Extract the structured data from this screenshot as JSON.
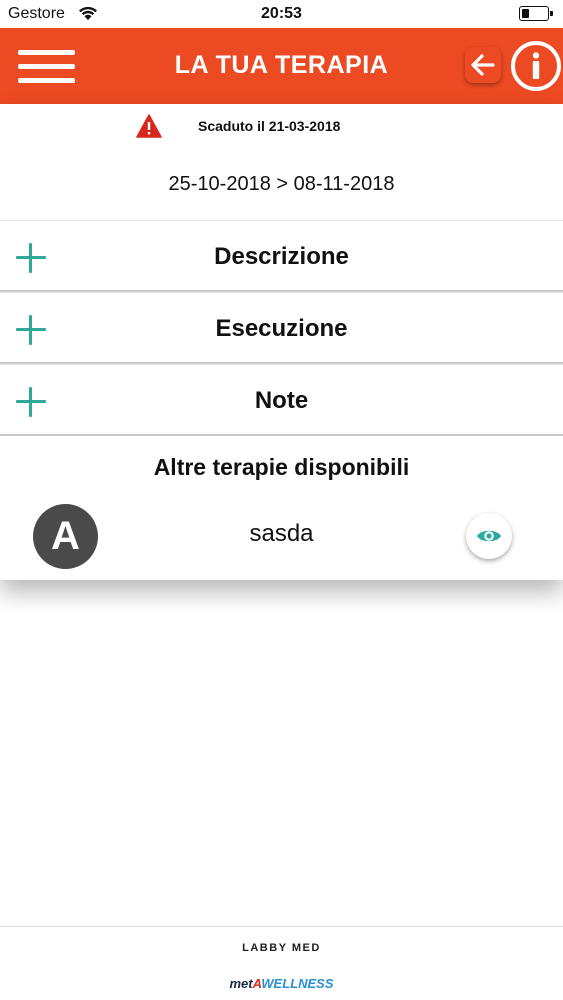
{
  "status_bar": {
    "carrier": "Gestore",
    "time": "20:53",
    "battery_level": 0.3
  },
  "header": {
    "title": "LA TUA TERAPIA",
    "menu_icon": "hamburger-icon",
    "back_icon": "arrow-left-icon",
    "info_icon": "info-icon"
  },
  "therapy": {
    "expired_text": "Scaduto il 21-03-2018",
    "date_range": "25-10-2018 > 08-11-2018"
  },
  "sections": [
    {
      "label": "Descrizione"
    },
    {
      "label": "Esecuzione"
    },
    {
      "label": "Note"
    }
  ],
  "other_therapies": {
    "title": "Altre terapie disponibili",
    "items": [
      {
        "initial": "A",
        "name": "sasda"
      }
    ]
  },
  "colors": {
    "header": "#ec4a22",
    "accent": "#2ea89a",
    "warning": "#d9261c",
    "avatar": "#4a4a4a"
  },
  "footer": {
    "brand1": "LABBY MED",
    "brand2_part1": "met",
    "brand2_part2": "A",
    "brand2_part3": "WELLNESS"
  }
}
